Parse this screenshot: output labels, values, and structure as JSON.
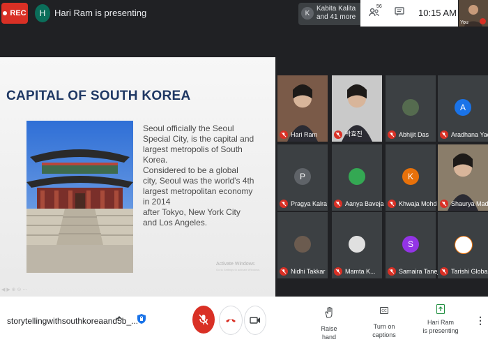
{
  "top_bar": {
    "rec_label": "REC",
    "presenter_initial": "H",
    "presenter_text": "Hari Ram is presenting",
    "others_initial": "K",
    "others_line1": "Kabita Kalita",
    "others_line2": "and 41 more",
    "people_count": "56",
    "clock": "10:15 AM",
    "self_label": "You"
  },
  "slide": {
    "title": "CAPITAL OF SOUTH KOREA",
    "paragraph1": "Seoul officially the Seoul Special City, is the capital and largest metropolis of South Korea.",
    "paragraph2": "Considered to be a global city, Seoul was the world's 4th largest metropolitan economy in 2014",
    "paragraph3": "after Tokyo, New York City and Los Angeles.",
    "watermark_line1": "Activate Windows",
    "watermark_line2": "Go to Settings to activate Windows."
  },
  "participants": [
    {
      "name": "Hari Ram",
      "initial": "",
      "avatar_color": "#7a5a48",
      "video": true
    },
    {
      "name": "박효진",
      "initial": "",
      "avatar_color": "#c9c9c9",
      "video": true
    },
    {
      "name": "Abhijit Das",
      "initial": "",
      "avatar_color": "#556b4f",
      "video": false
    },
    {
      "name": "Aradhana Yad...",
      "initial": "A",
      "avatar_color": "#1a73e8",
      "video": false
    },
    {
      "name": "Pragya Kalra",
      "initial": "P",
      "avatar_color": "#5f6368",
      "video": false
    },
    {
      "name": "Aanya Baveja",
      "initial": "",
      "avatar_color": "#34a853",
      "video": false
    },
    {
      "name": "Khwaja Mohd ...",
      "initial": "K",
      "avatar_color": "#e8710a",
      "video": false
    },
    {
      "name": "Shaurya Mad...",
      "initial": "",
      "avatar_color": "#8a7d6a",
      "video": true
    },
    {
      "name": "Nidhi Takkar",
      "initial": "",
      "avatar_color": "#6b5b4f",
      "video": false
    },
    {
      "name": "Mamta K...",
      "initial": "",
      "avatar_color": "#e0e0e0",
      "video": false
    },
    {
      "name": "Samaira Taneja",
      "initial": "S",
      "avatar_color": "#9334e6",
      "video": false
    },
    {
      "name": "Tarishi Global",
      "initial": "",
      "avatar_color": "#ffffff",
      "video": false
    }
  ],
  "bottom_bar": {
    "meeting_code": "storytellingwithsouthkoreaand5b_...",
    "raise_hand": "Raise hand",
    "captions": "Turn on captions",
    "presenting_line1": "Hari Ram",
    "presenting_line2": "is presenting"
  },
  "colors": {
    "record_red": "#d93025",
    "tile_bg": "#3c4043",
    "meet_bg": "#202124",
    "slide_title": "#1f3864"
  }
}
